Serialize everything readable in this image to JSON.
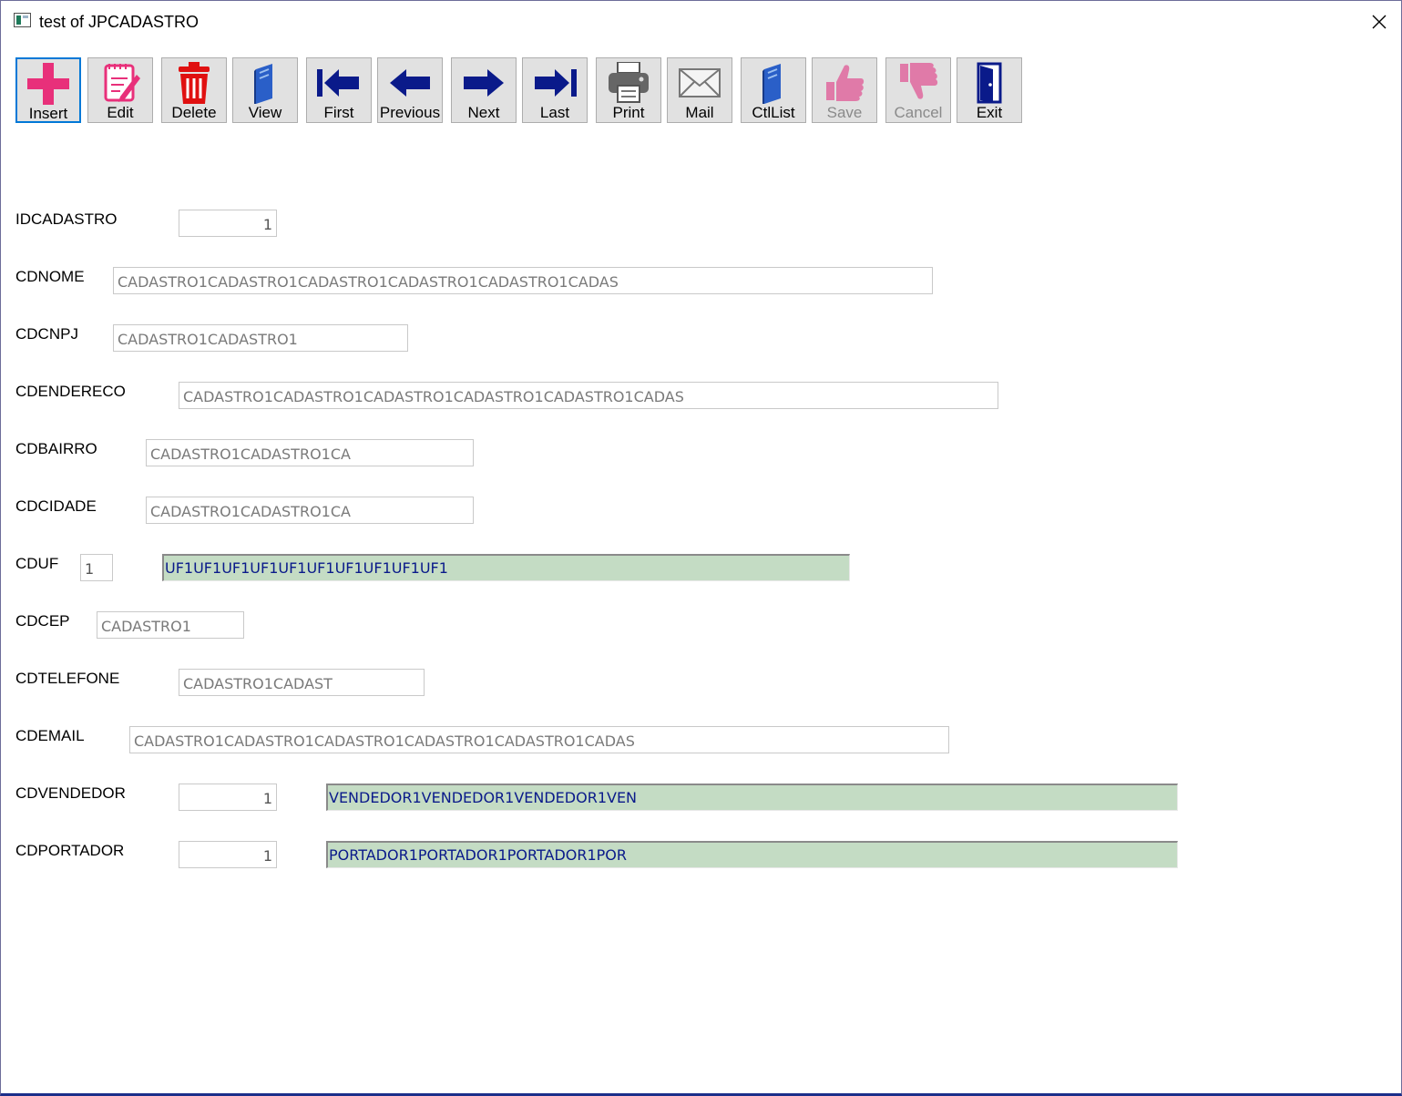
{
  "window": {
    "title": "test of JPCADASTRO"
  },
  "toolbar": {
    "buttons": [
      {
        "label": "Insert",
        "icon": "plus-icon",
        "enabled": true,
        "color": "#e8307a"
      },
      {
        "label": "Edit",
        "icon": "edit-icon",
        "enabled": true,
        "color": "#e8307a"
      },
      {
        "label": "Delete",
        "icon": "trash-icon",
        "enabled": true,
        "color": "#e01010"
      },
      {
        "label": "View",
        "icon": "book-icon",
        "enabled": true,
        "color": "#2a5fc8"
      },
      {
        "label": "First",
        "icon": "first-arrow-icon",
        "enabled": true,
        "color": "#0a1a8a"
      },
      {
        "label": "Previous",
        "icon": "left-arrow-icon",
        "enabled": true,
        "color": "#0a1a8a"
      },
      {
        "label": "Next",
        "icon": "right-arrow-icon",
        "enabled": true,
        "color": "#0a1a8a"
      },
      {
        "label": "Last",
        "icon": "last-arrow-icon",
        "enabled": true,
        "color": "#0a1a8a"
      },
      {
        "label": "Print",
        "icon": "printer-icon",
        "enabled": true,
        "color": "#555555"
      },
      {
        "label": "Mail",
        "icon": "envelope-icon",
        "enabled": true,
        "color": "#777777"
      },
      {
        "label": "CtlList",
        "icon": "book-icon",
        "enabled": true,
        "color": "#2a5fc8"
      },
      {
        "label": "Save",
        "icon": "thumbs-up-icon",
        "enabled": false,
        "color": "#e07aa8"
      },
      {
        "label": "Cancel",
        "icon": "thumbs-down-icon",
        "enabled": false,
        "color": "#e07aa8"
      },
      {
        "label": "Exit",
        "icon": "door-exit-icon",
        "enabled": true,
        "color": "#0a1a8a"
      }
    ]
  },
  "form": {
    "idcadastro": {
      "label": "IDCADASTRO",
      "value": "1"
    },
    "cdnome": {
      "label": "CDNOME",
      "value": "CADASTRO1CADASTRO1CADASTRO1CADASTRO1CADASTRO1CADAS"
    },
    "cdcnpj": {
      "label": "CDCNPJ",
      "value": "CADASTRO1CADASTRO1"
    },
    "cdendereco": {
      "label": "CDENDERECO",
      "value": "CADASTRO1CADASTRO1CADASTRO1CADASTRO1CADASTRO1CADAS"
    },
    "cdbairro": {
      "label": "CDBAIRRO",
      "value": "CADASTRO1CADASTRO1CA"
    },
    "cdcidade": {
      "label": "CDCIDADE",
      "value": "CADASTRO1CADASTRO1CA"
    },
    "cduf": {
      "label": "CDUF",
      "value": "1",
      "lookup": "UF1UF1UF1UF1UF1UF1UF1UF1UF1UF1"
    },
    "cdcep": {
      "label": "CDCEP",
      "value": "CADASTRO1"
    },
    "cdtelefone": {
      "label": "CDTELEFONE",
      "value": "CADASTRO1CADAST"
    },
    "cdemail": {
      "label": "CDEMAIL",
      "value": "CADASTRO1CADASTRO1CADASTRO1CADASTRO1CADASTRO1CADAS"
    },
    "cdvendedor": {
      "label": "CDVENDEDOR",
      "value": "1",
      "lookup": "VENDEDOR1VENDEDOR1VENDEDOR1VEN"
    },
    "cdportador": {
      "label": "CDPORTADOR",
      "value": "1",
      "lookup": "PORTADOR1PORTADOR1PORTADOR1POR"
    }
  },
  "colors": {
    "lookup_bg": "#c4dcc4",
    "lookup_text": "#0a1a8a",
    "focus_border": "#0078d7"
  }
}
